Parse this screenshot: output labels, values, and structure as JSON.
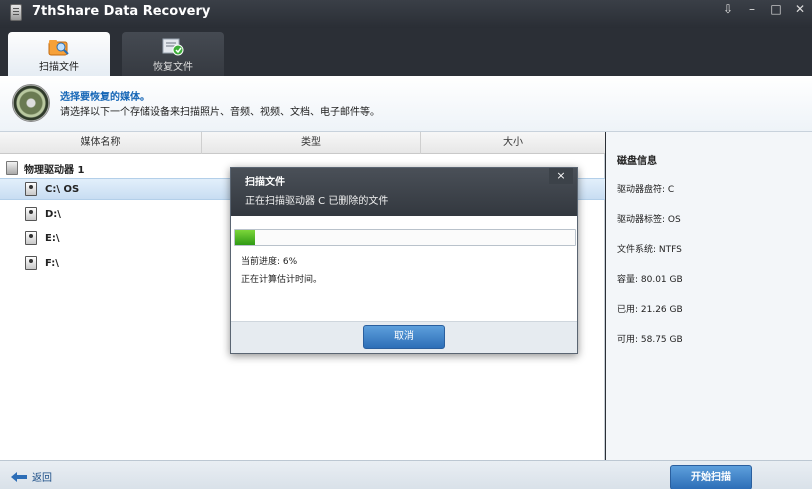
{
  "app": {
    "title": "7thShare Data Recovery",
    "window_buttons": [
      "⇩",
      "–",
      "□",
      "✕"
    ]
  },
  "tabs": [
    {
      "label": "扫描文件",
      "active": true,
      "icon": "scan-folder-icon"
    },
    {
      "label": "恢复文件",
      "active": false,
      "icon": "restore-files-icon"
    }
  ],
  "banner": {
    "title": "选择要恢复的媒体。",
    "description": "请选择以下一个存储设备来扫描照片、音频、视频、文档、电子邮件等。"
  },
  "table": {
    "columns": [
      "媒体名称",
      "类型",
      "大小"
    ],
    "root_label": "物理驱动器 1",
    "drives": [
      {
        "label": "C:\\ OS",
        "selected": true
      },
      {
        "label": "D:\\",
        "selected": false
      },
      {
        "label": "E:\\",
        "selected": false
      },
      {
        "label": "F:\\",
        "selected": false
      }
    ]
  },
  "disk_info": {
    "title": "磁盘信息",
    "rows": [
      "驱动器盘符: C",
      "驱动器标签: OS",
      "文件系统: NTFS",
      "容量: 80.01 GB",
      "已用: 21.26 GB",
      "可用: 58.75 GB"
    ]
  },
  "dialog": {
    "title": "扫描文件",
    "subtitle": "正在扫描驱动器 C 已删除的文件",
    "close": "×",
    "progress_fraction": 0.06,
    "progress_text": "当前进度: 6%",
    "eta_text": "正在计算估计时间。",
    "cancel_label": "取消"
  },
  "footer": {
    "back_label": "返回",
    "start_label": "开始扫描"
  },
  "colors": {
    "accent_blue": "#2d6eb7",
    "progress_green": "#2f9a14",
    "title_blue": "#1566b6"
  }
}
